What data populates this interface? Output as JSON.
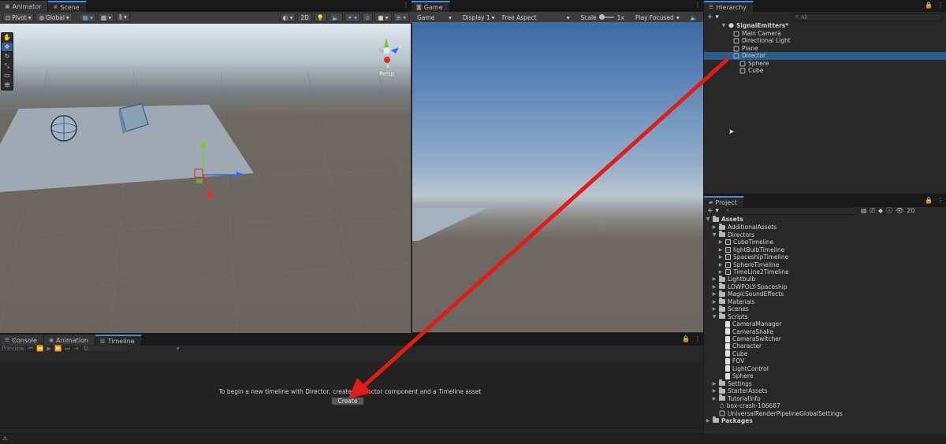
{
  "scene_panel": {
    "tabs": [
      {
        "label": "Animator"
      },
      {
        "label": "Scene"
      }
    ],
    "toolbar": {
      "pivot": "Pivot",
      "global": "Global",
      "mode_2d": "2D"
    },
    "gizmo": {
      "label": "Persp",
      "x": "x",
      "z": "z"
    }
  },
  "game_panel": {
    "tab": "Game",
    "toolbar": {
      "mode": "Game",
      "display": "Display 1",
      "aspect": "Free Aspect",
      "scale_label": "Scale",
      "scale_value": "1x",
      "play_mode": "Play Focused"
    }
  },
  "hierarchy": {
    "tab": "Hierarchy",
    "search_placeholder": "All",
    "scene": "SignalEmitters*",
    "items": [
      {
        "label": "Main Camera"
      },
      {
        "label": "Directional Light"
      },
      {
        "label": "Plane"
      },
      {
        "label": "Director"
      },
      {
        "label": "Sphere"
      },
      {
        "label": "Cube"
      }
    ]
  },
  "project": {
    "tab": "Project",
    "badge_count": "20",
    "assets_label": "Assets",
    "packages_label": "Packages",
    "items": [
      {
        "label": "AdditionalAssets"
      },
      {
        "label": "Directors"
      },
      {
        "label": "CubeTimeline"
      },
      {
        "label": "lightBulbTimeline"
      },
      {
        "label": "SpaceshipTimeline"
      },
      {
        "label": "SphereTimeline"
      },
      {
        "label": "TimeLine2Timeline"
      },
      {
        "label": "Lightbulb"
      },
      {
        "label": "LOWPOLY-Spaceship"
      },
      {
        "label": "MagicSoundEffects"
      },
      {
        "label": "Materials"
      },
      {
        "label": "Scenes"
      },
      {
        "label": "Scripts"
      },
      {
        "label": "CameraManager"
      },
      {
        "label": "CameraShake"
      },
      {
        "label": "CameraSwitcher"
      },
      {
        "label": "Character"
      },
      {
        "label": "Cube"
      },
      {
        "label": "FOV"
      },
      {
        "label": "LightControl"
      },
      {
        "label": "Sphere"
      },
      {
        "label": "Settings"
      },
      {
        "label": "StarterAssets"
      },
      {
        "label": "TutorialInfo"
      },
      {
        "label": "box-crash-106687"
      },
      {
        "label": "UniversalRenderPipelineGlobalSettings"
      }
    ]
  },
  "timeline_panel": {
    "tabs": [
      {
        "label": "Console"
      },
      {
        "label": "Animation"
      },
      {
        "label": "Timeline"
      }
    ],
    "preview_label": "Preview",
    "frame_value": "0",
    "message": "To begin a new timeline with Director, create a Director component and a Timeline asset",
    "create_button": "Create"
  },
  "colors": {
    "accent": "#4a8bd6",
    "selection": "#2c5d87",
    "annotation_arrow": "#e41b17"
  }
}
